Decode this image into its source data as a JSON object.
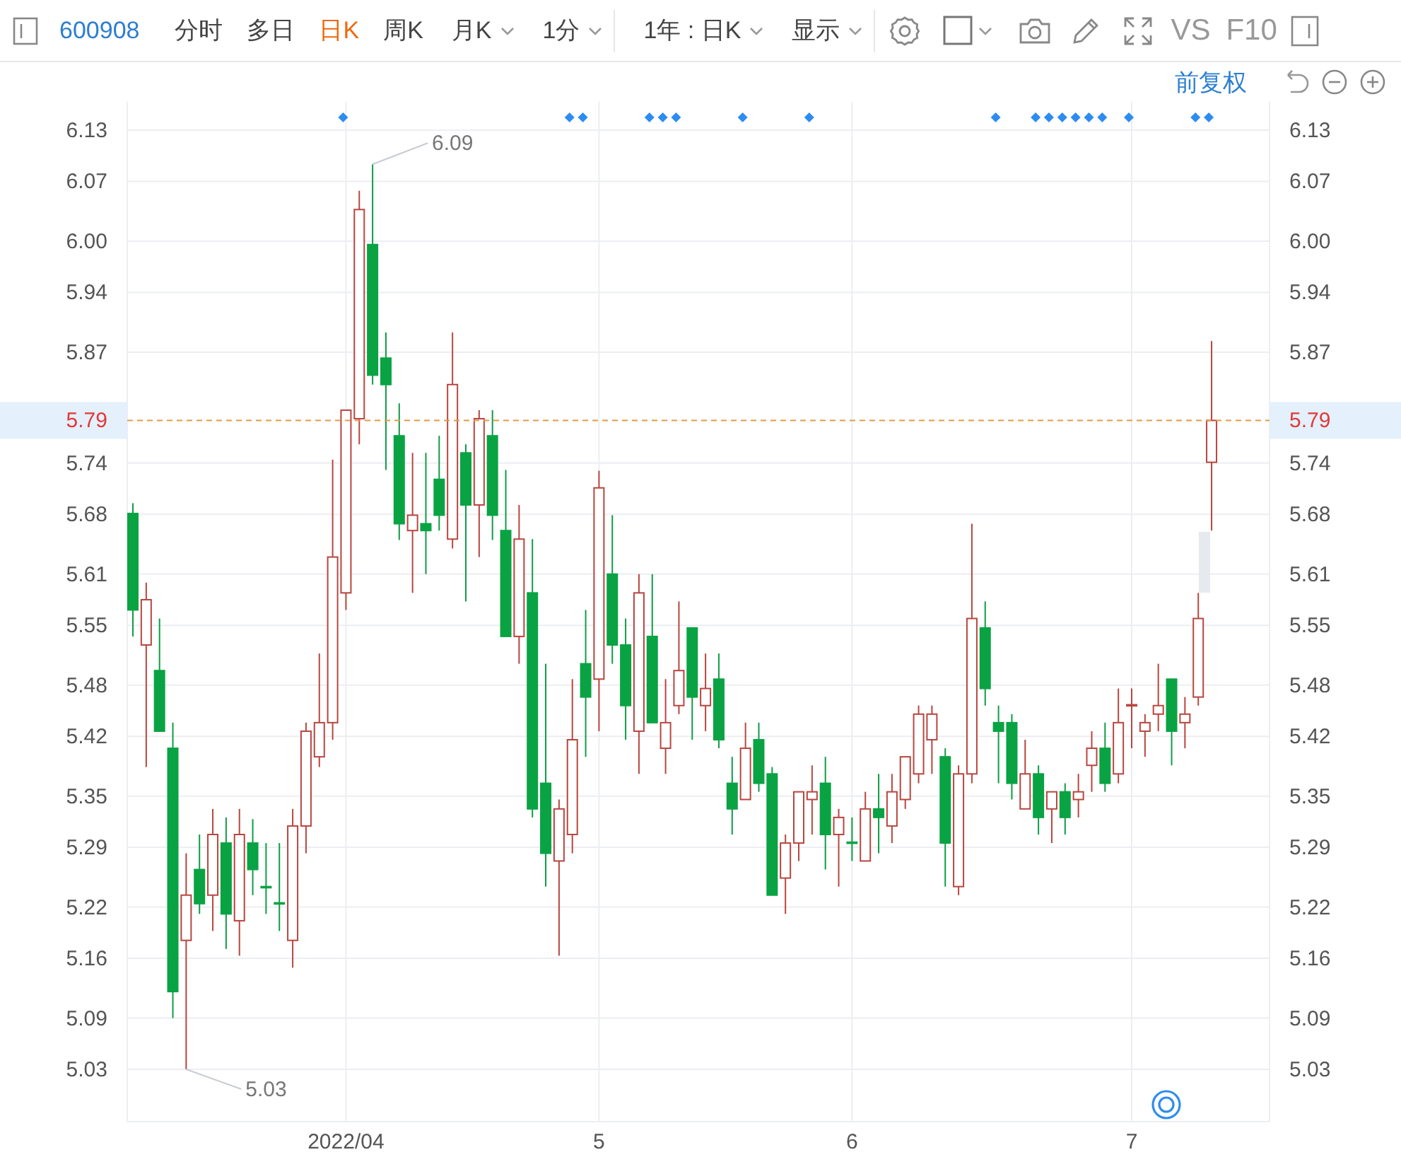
{
  "toolbar": {
    "code": "600908",
    "periods": [
      {
        "label": "分时",
        "selected": false,
        "kind": "tab"
      },
      {
        "label": "多日",
        "selected": false,
        "kind": "tab"
      },
      {
        "label": "日K",
        "selected": true,
        "kind": "tab"
      },
      {
        "label": "周K",
        "selected": false,
        "kind": "tab"
      },
      {
        "label": "月K",
        "selected": false,
        "kind": "dropdown"
      },
      {
        "label": "1分",
        "selected": false,
        "kind": "dropdown"
      }
    ],
    "range_select": "1年 : 日K",
    "display_select": "显示",
    "compare": "VS",
    "f10": "F10"
  },
  "subbar": {
    "adjust": "前复权"
  },
  "chart": {
    "chart_data": {
      "type": "candlestick",
      "ylim": [
        5.03,
        6.13
      ],
      "grid": true,
      "categories": [
        null,
        null,
        null,
        null,
        null,
        null,
        null,
        null,
        null,
        null,
        null,
        null,
        null,
        null,
        null,
        null,
        "2022/04",
        null,
        null,
        null,
        null,
        null,
        null,
        null,
        null,
        null,
        null,
        null,
        null,
        null,
        null,
        null,
        null,
        null,
        null,
        "5",
        null,
        null,
        null,
        null,
        null,
        null,
        null,
        null,
        null,
        null,
        null,
        null,
        null,
        null,
        null,
        null,
        null,
        null,
        "6",
        null,
        null,
        null,
        null,
        null,
        null,
        null,
        null,
        null,
        null,
        null,
        null,
        null,
        null,
        null,
        null,
        null,
        null,
        null,
        null,
        "7",
        null,
        null,
        null,
        null,
        null,
        null
      ],
      "yticks": [
        6.13,
        6.07,
        {
          "value": 6,
          "label": "6.00"
        },
        5.94,
        5.87,
        5.74,
        5.68,
        5.61,
        5.55,
        5.48,
        5.42,
        5.35,
        5.29,
        5.22,
        5.16,
        5.09,
        5.03
      ],
      "ohlc": [
        [
          5.681,
          5.693,
          5.537,
          5.568
        ],
        [
          5.527,
          5.6,
          5.384,
          5.58
        ],
        [
          5.497,
          5.558,
          5.426,
          5.426
        ],
        [
          5.406,
          5.436,
          5.09,
          5.121
        ],
        [
          5.181,
          5.283,
          5.03,
          5.234
        ],
        [
          5.264,
          5.305,
          5.212,
          5.224
        ],
        [
          5.234,
          5.335,
          5.192,
          5.305
        ],
        [
          5.295,
          5.325,
          5.171,
          5.212
        ],
        [
          5.204,
          5.335,
          5.163,
          5.305
        ],
        [
          5.295,
          5.323,
          5.234,
          5.264
        ],
        [
          5.244,
          5.295,
          5.212,
          5.243
        ],
        [
          5.225,
          5.295,
          5.192,
          5.224
        ],
        [
          5.181,
          5.335,
          5.149,
          5.315
        ],
        [
          5.315,
          5.436,
          5.283,
          5.426
        ],
        [
          5.396,
          5.517,
          5.384,
          5.436
        ],
        [
          5.436,
          5.744,
          5.416,
          5.63
        ],
        [
          5.588,
          5.802,
          5.568,
          5.802
        ],
        [
          5.792,
          6.059,
          5.762,
          6.037
        ],
        [
          5.996,
          6.09,
          5.832,
          5.843
        ],
        [
          5.863,
          5.893,
          5.732,
          5.832
        ],
        [
          5.772,
          5.81,
          5.65,
          5.669
        ],
        [
          5.661,
          5.752,
          5.588,
          5.679
        ],
        [
          5.669,
          5.752,
          5.61,
          5.661
        ],
        [
          5.721,
          5.772,
          5.661,
          5.679
        ],
        [
          5.651,
          5.893,
          5.64,
          5.832
        ],
        [
          5.752,
          5.762,
          5.578,
          5.691
        ],
        [
          5.691,
          5.802,
          5.63,
          5.792
        ],
        [
          5.772,
          5.802,
          5.65,
          5.679
        ],
        [
          5.661,
          5.732,
          5.537,
          5.537
        ],
        [
          5.537,
          5.691,
          5.505,
          5.651
        ],
        [
          5.588,
          5.651,
          5.325,
          5.335
        ],
        [
          5.365,
          5.505,
          5.244,
          5.283
        ],
        [
          5.274,
          5.346,
          5.163,
          5.335
        ],
        [
          5.305,
          5.487,
          5.283,
          5.416
        ],
        [
          5.505,
          5.568,
          5.396,
          5.466
        ],
        [
          5.487,
          5.731,
          5.426,
          5.711
        ],
        [
          5.61,
          5.679,
          5.505,
          5.527
        ],
        [
          5.527,
          5.558,
          5.416,
          5.456
        ],
        [
          5.426,
          5.61,
          5.376,
          5.588
        ],
        [
          5.537,
          5.61,
          5.436,
          5.436
        ],
        [
          5.406,
          5.487,
          5.376,
          5.436
        ],
        [
          5.456,
          5.578,
          5.446,
          5.497
        ],
        [
          5.547,
          5.547,
          5.416,
          5.466
        ],
        [
          5.456,
          5.517,
          5.426,
          5.476
        ],
        [
          5.487,
          5.517,
          5.406,
          5.416
        ],
        [
          5.365,
          5.396,
          5.305,
          5.335
        ],
        [
          5.346,
          5.436,
          5.346,
          5.406
        ],
        [
          5.416,
          5.436,
          5.355,
          5.365
        ],
        [
          5.376,
          5.384,
          5.234,
          5.234
        ],
        [
          5.254,
          5.305,
          5.212,
          5.295
        ],
        [
          5.295,
          5.355,
          5.274,
          5.355
        ],
        [
          5.346,
          5.386,
          5.305,
          5.355
        ],
        [
          5.365,
          5.396,
          5.264,
          5.305
        ],
        [
          5.305,
          5.335,
          5.244,
          5.325
        ],
        [
          5.296,
          5.325,
          5.274,
          5.295
        ],
        [
          5.274,
          5.355,
          5.274,
          5.335
        ],
        [
          5.335,
          5.376,
          5.283,
          5.325
        ],
        [
          5.315,
          5.376,
          5.295,
          5.355
        ],
        [
          5.346,
          5.396,
          5.335,
          5.396
        ],
        [
          5.376,
          5.456,
          5.365,
          5.446
        ],
        [
          5.416,
          5.456,
          5.376,
          5.446
        ],
        [
          5.396,
          5.406,
          5.244,
          5.295
        ],
        [
          5.244,
          5.386,
          5.234,
          5.376
        ],
        [
          5.376,
          5.669,
          5.365,
          5.558
        ],
        [
          5.547,
          5.578,
          5.456,
          5.476
        ],
        [
          5.436,
          5.456,
          5.365,
          5.426
        ],
        [
          5.436,
          5.446,
          5.346,
          5.365
        ],
        [
          5.335,
          5.416,
          5.335,
          5.376
        ],
        [
          5.376,
          5.386,
          5.305,
          5.325
        ],
        [
          5.335,
          5.355,
          5.295,
          5.355
        ],
        [
          5.355,
          5.365,
          5.305,
          5.325
        ],
        [
          5.346,
          5.376,
          5.325,
          5.355
        ],
        [
          5.386,
          5.426,
          5.355,
          5.406
        ],
        [
          5.406,
          5.436,
          5.355,
          5.365
        ],
        [
          5.376,
          5.476,
          5.365,
          5.436
        ],
        [
          5.456,
          5.476,
          5.406,
          5.457
        ],
        [
          5.426,
          5.446,
          5.396,
          5.436
        ],
        [
          5.446,
          5.505,
          5.426,
          5.456
        ],
        [
          5.487,
          5.487,
          5.386,
          5.426
        ],
        [
          5.436,
          5.466,
          5.406,
          5.446
        ],
        [
          5.466,
          5.588,
          5.456,
          5.558
        ],
        [
          5.741,
          5.883,
          5.661,
          5.79
        ]
      ],
      "annotations": [
        "6.09",
        "5.03"
      ],
      "ref_lines": [
        {
          "axis": "y",
          "value": 5.79,
          "label": "5.79"
        }
      ]
    },
    "right_axis": {
      "labels": [
        "6.13",
        "6.07",
        "6.00",
        "5.94",
        "5.87",
        "5.74",
        "5.68",
        "5.61",
        "5.55",
        "5.48",
        "5.42",
        "5.35",
        "5.29",
        "5.22",
        "5.16",
        "5.09",
        "5.03"
      ],
      "price_label": "5.79"
    },
    "event_marks": [
      false,
      false,
      false,
      false,
      false,
      false,
      false,
      false,
      false,
      false,
      false,
      false,
      false,
      false,
      false,
      false,
      true,
      false,
      false,
      false,
      false,
      false,
      false,
      false,
      false,
      false,
      false,
      false,
      false,
      false,
      false,
      false,
      false,
      true,
      true,
      false,
      false,
      false,
      false,
      true,
      true,
      true,
      false,
      false,
      false,
      false,
      true,
      false,
      false,
      false,
      false,
      true,
      false,
      false,
      false,
      false,
      false,
      false,
      false,
      false,
      false,
      false,
      false,
      false,
      false,
      true,
      false,
      false,
      true,
      true,
      true,
      true,
      true,
      true,
      false,
      true,
      false,
      false,
      false,
      false,
      true,
      true
    ]
  }
}
